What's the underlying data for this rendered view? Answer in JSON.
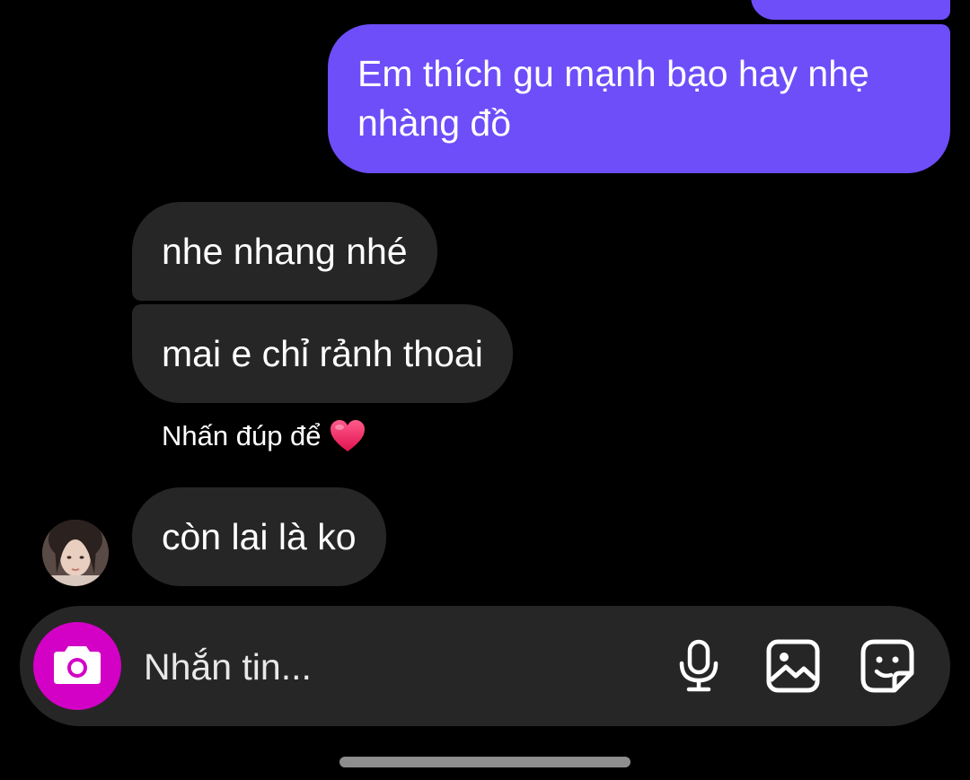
{
  "messages": {
    "outgoing": [
      {
        "text": "Em thích gu mạnh bạo hay nhẹ nhàng đồ"
      }
    ],
    "incoming": [
      {
        "text": "nhe nhang nhé"
      },
      {
        "text": "mai e chỉ rảnh thoai"
      },
      {
        "text": "còn lai là ko"
      }
    ],
    "reaction_hint": "Nhấn đúp để",
    "reaction_icon": "heart-icon"
  },
  "composer": {
    "placeholder": "Nhắn tin...",
    "icons": [
      "camera-icon",
      "microphone-icon",
      "gallery-icon",
      "sticker-icon"
    ]
  },
  "colors": {
    "outgoing_bubble": "#6d4ef9",
    "incoming_bubble": "#262626",
    "camera_button": "#d300c5",
    "background": "#000000"
  }
}
